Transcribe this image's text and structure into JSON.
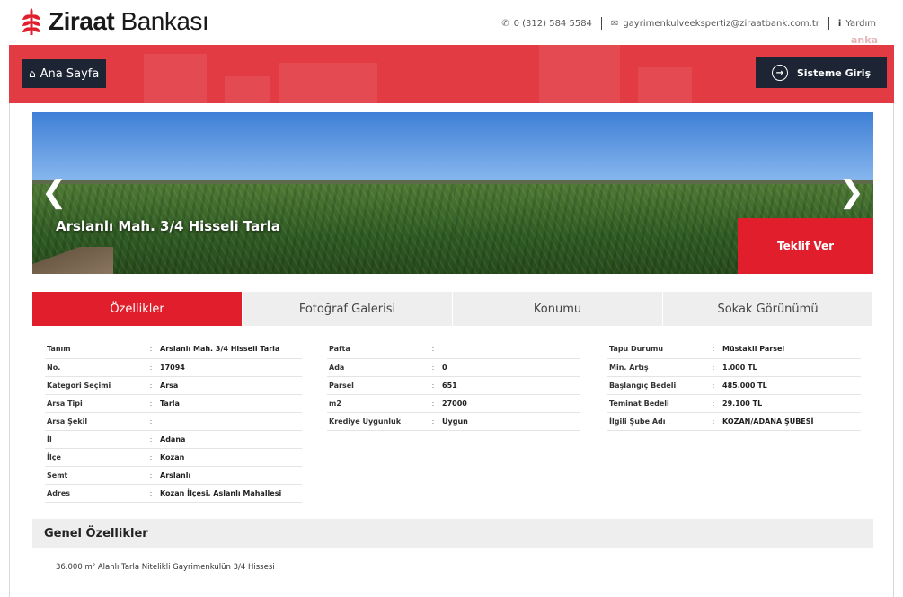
{
  "brand": {
    "name_bold": "Ziraat",
    "name_rest": " Bankası",
    "logo_icon": "wheat-icon"
  },
  "contact": {
    "phone": "0 (312) 584 5584",
    "email": "gayrimenkulveekspertiz@ziraatbank.com.tr",
    "help": "Yardım"
  },
  "watermark": "anka",
  "nav": {
    "home_label": "Ana Sayfa",
    "login_label": "Sisteme Giriş"
  },
  "carousel": {
    "title": "Arslanlı Mah. 3/4 Hisseli Tarla",
    "offer_label": "Teklif Ver",
    "prev_icon": "chevron-left-icon",
    "next_icon": "chevron-right-icon"
  },
  "tabs": [
    {
      "label": "Özellikler",
      "active": true
    },
    {
      "label": "Fotoğraf Galerisi",
      "active": false
    },
    {
      "label": "Konumu",
      "active": false
    },
    {
      "label": "Sokak Görünümü",
      "active": false
    }
  ],
  "details": {
    "col1": [
      {
        "label": "Tanım",
        "value": "Arslanlı Mah. 3/4 Hisseli Tarla"
      },
      {
        "label": "No.",
        "value": "17094"
      },
      {
        "label": "Kategori Seçimi",
        "value": "Arsa"
      },
      {
        "label": "Arsa Tipi",
        "value": "Tarla"
      },
      {
        "label": "Arsa Şekil",
        "value": ""
      },
      {
        "label": "İl",
        "value": "Adana"
      },
      {
        "label": "İlçe",
        "value": "Kozan"
      },
      {
        "label": "Semt",
        "value": "Arslanlı"
      },
      {
        "label": "Adres",
        "value": "Kozan İlçesi, Aslanlı Mahallesi"
      }
    ],
    "col2": [
      {
        "label": "Pafta",
        "value": ""
      },
      {
        "label": "Ada",
        "value": "0"
      },
      {
        "label": "Parsel",
        "value": "651"
      },
      {
        "label": "m2",
        "value": "27000"
      },
      {
        "label": "Krediye Uygunluk",
        "value": "Uygun"
      }
    ],
    "col3": [
      {
        "label": "Tapu Durumu",
        "value": "Müstakil Parsel"
      },
      {
        "label": "Min. Artış",
        "value": "1.000 TL"
      },
      {
        "label": "Başlangıç Bedeli",
        "value": "485.000 TL"
      },
      {
        "label": "Teminat Bedeli",
        "value": "29.100 TL"
      },
      {
        "label": "İlgili Şube Adı",
        "value": "KOZAN/ADANA ŞUBESİ"
      }
    ],
    "separator": ":"
  },
  "general": {
    "heading": "Genel Özellikler",
    "text": "36.000 m² Alanlı Tarla Nitelikli Gayrimenkulün 3/4 Hissesi"
  },
  "colors": {
    "brand_red": "#e11f2c",
    "hero_red": "#e23b43",
    "dark_navy": "#1d2433"
  }
}
